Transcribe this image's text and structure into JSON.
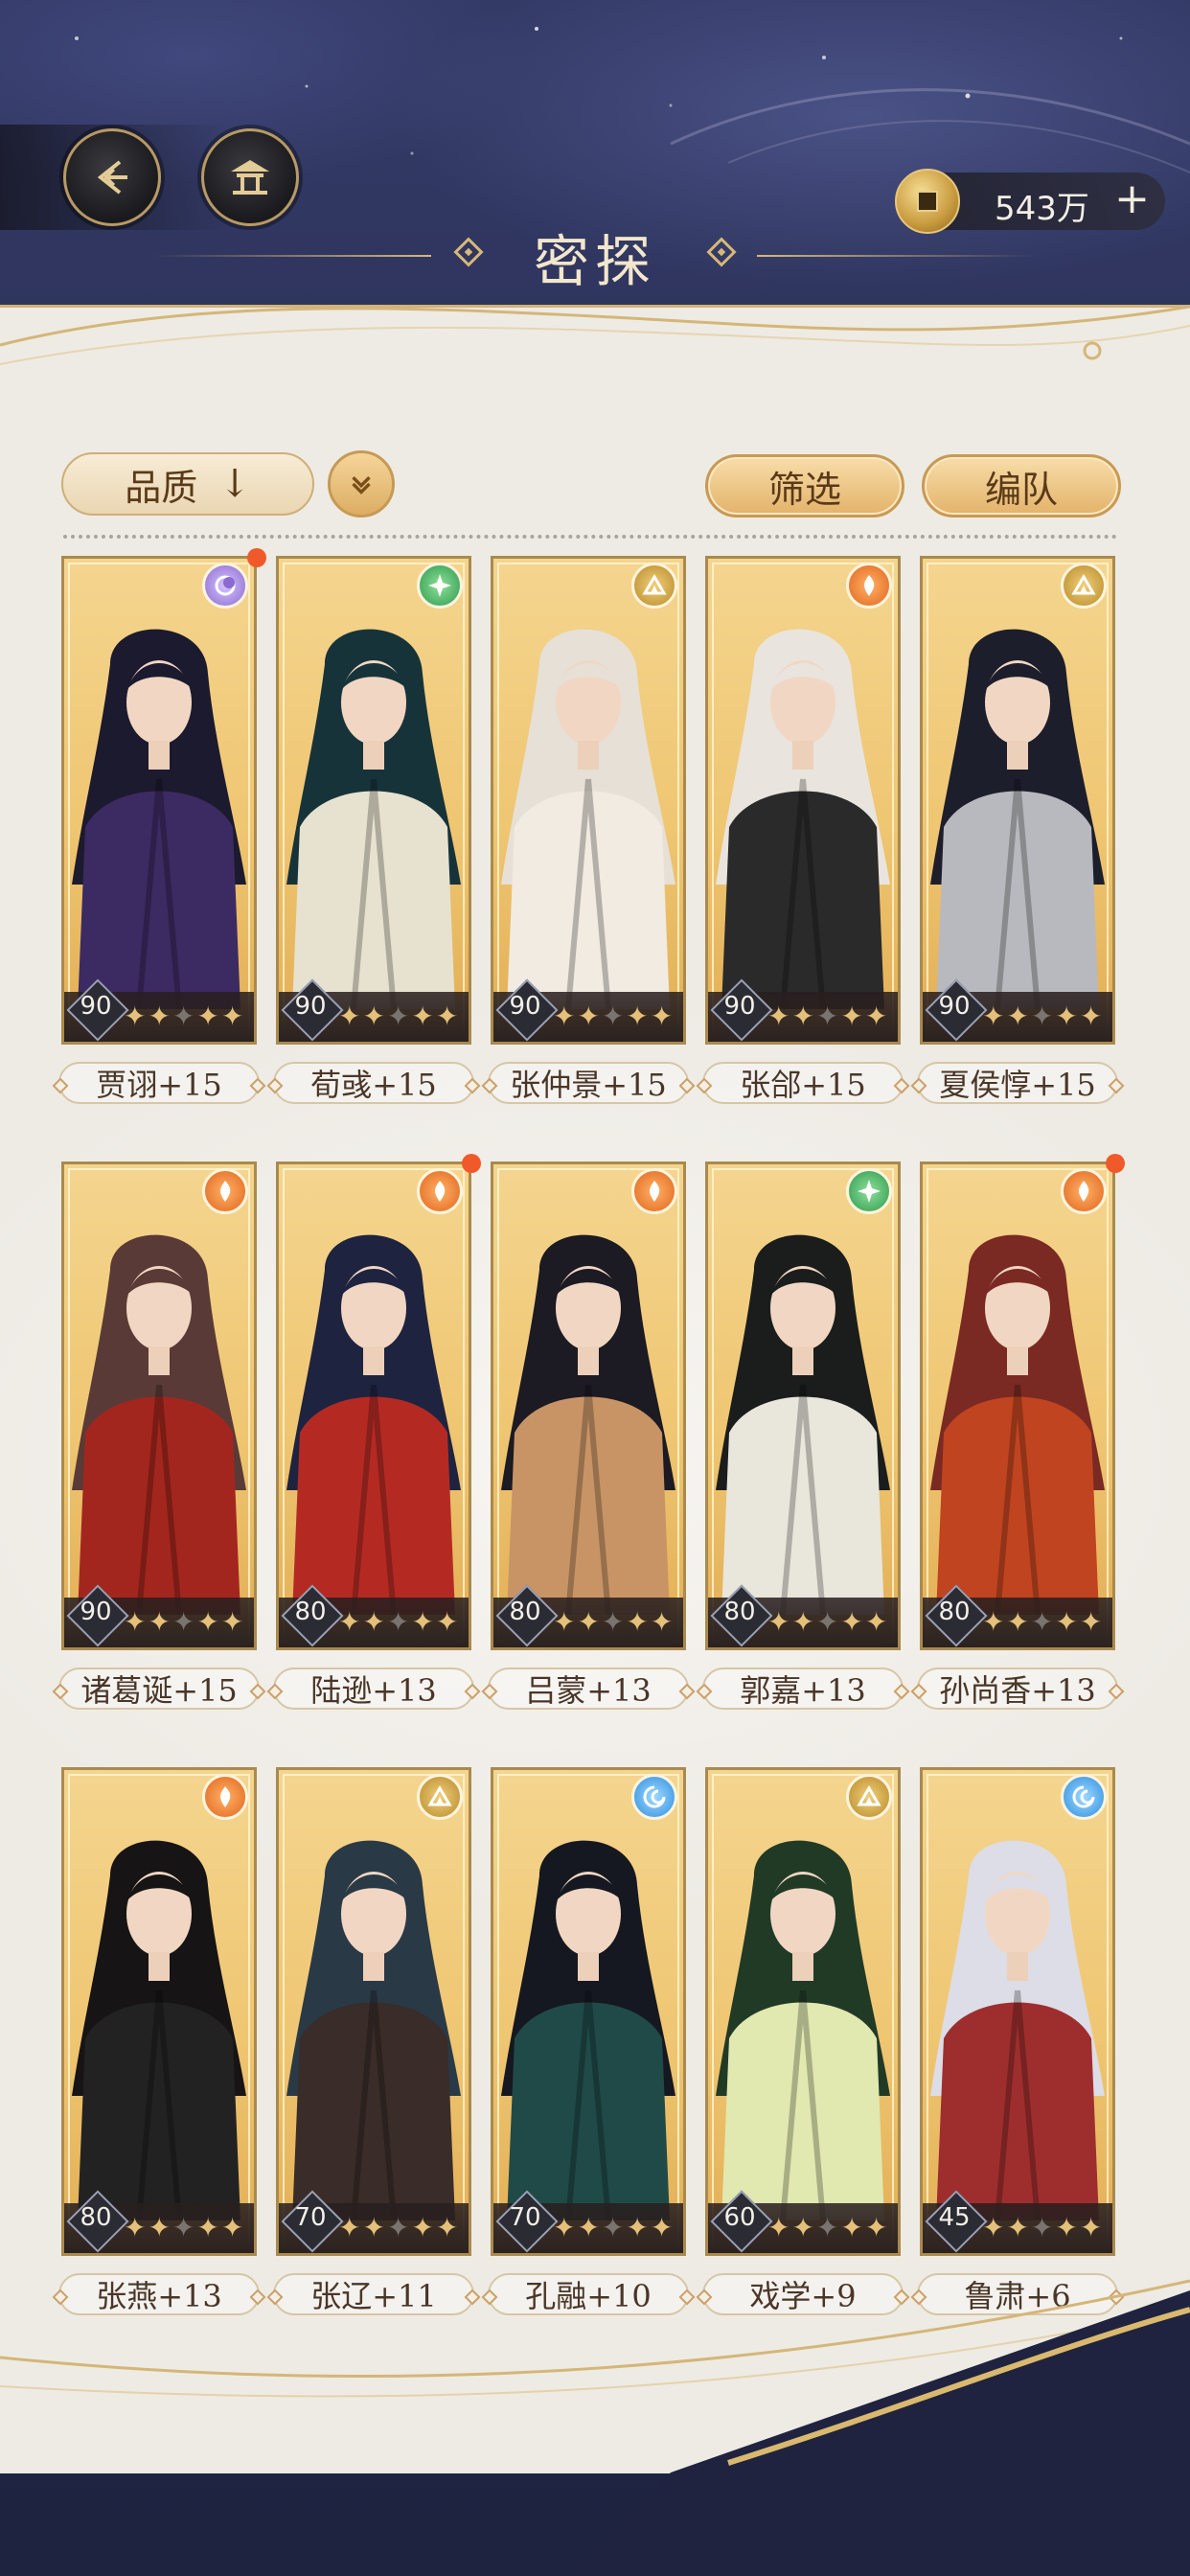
{
  "header": {
    "title": "密探",
    "back_icon": "back-arrow-icon",
    "home_icon": "pavilion-icon",
    "currency": {
      "icon": "coin-icon",
      "amount": "543万",
      "add_label": "+"
    }
  },
  "toolbar": {
    "quality_label": "品质",
    "sort_arrow": "↓",
    "filter_label": "筛选",
    "team_label": "编队"
  },
  "cards": [
    {
      "name": "贾诩+15",
      "level": "90",
      "element": "lunar",
      "dot": true
    },
    {
      "name": "荀彧+15",
      "level": "90",
      "element": "wind",
      "dot": false
    },
    {
      "name": "张仲景+15",
      "level": "90",
      "element": "earth",
      "dot": false
    },
    {
      "name": "张郃+15",
      "level": "90",
      "element": "fire",
      "dot": false
    },
    {
      "name": "夏侯惇+15",
      "level": "90",
      "element": "earth",
      "dot": false
    },
    {
      "name": "诸葛诞+15",
      "level": "90",
      "element": "fire",
      "dot": false
    },
    {
      "name": "陆逊+13",
      "level": "80",
      "element": "fire",
      "dot": true
    },
    {
      "name": "吕蒙+13",
      "level": "80",
      "element": "fire",
      "dot": false
    },
    {
      "name": "郭嘉+13",
      "level": "80",
      "element": "wind",
      "dot": false
    },
    {
      "name": "孙尚香+13",
      "level": "80",
      "element": "fire",
      "dot": true
    },
    {
      "name": "张燕+13",
      "level": "80",
      "element": "fire",
      "dot": false
    },
    {
      "name": "张辽+11",
      "level": "70",
      "element": "earth",
      "dot": false
    },
    {
      "name": "孔融+10",
      "level": "70",
      "element": "water",
      "dot": false
    },
    {
      "name": "戏学+9",
      "level": "60",
      "element": "earth",
      "dot": false
    },
    {
      "name": "鲁肃+6",
      "level": "45",
      "element": "water",
      "dot": false
    }
  ],
  "colors": {
    "gold": "#e2ae55",
    "fire": "#e0661e",
    "wind": "#2e9a4e",
    "earth": "#b88a2a",
    "water": "#2f8fe0",
    "lunar": "#8a6ad0"
  }
}
